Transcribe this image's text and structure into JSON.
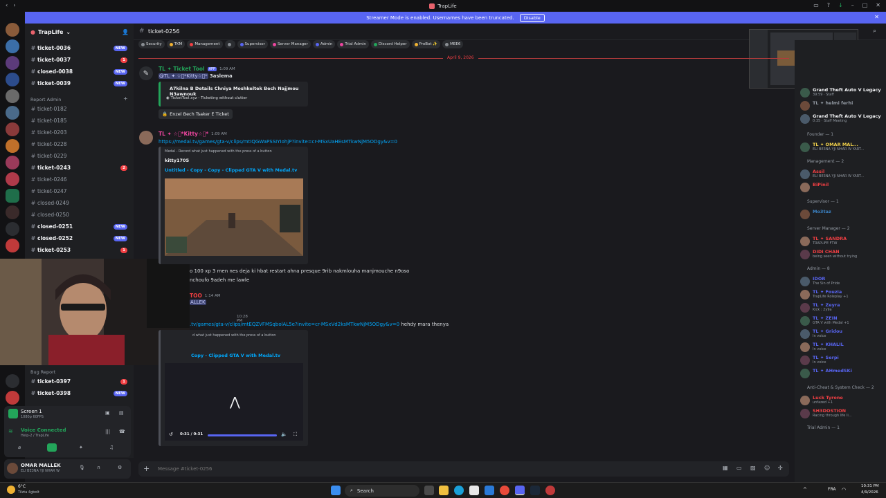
{
  "window": {
    "title": "TrapLife"
  },
  "banner": {
    "text": "Streamer Mode is enabled. Usernames have been truncated.",
    "disable": "Disable"
  },
  "server": {
    "name": "TrapLife"
  },
  "channels": [
    {
      "name": "ticket-0036",
      "bold": true,
      "badge": "NEW"
    },
    {
      "name": "ticket-0037",
      "bold": true,
      "badge": "1"
    },
    {
      "name": "closed-0038",
      "bold": true,
      "badge": "NEW"
    },
    {
      "name": "ticket-0039",
      "bold": true,
      "badge": "NEW"
    }
  ],
  "report_category": "Report Admin",
  "report_channels": [
    {
      "name": "ticket-0182",
      "bold": false,
      "badge": ""
    },
    {
      "name": "ticket-0185",
      "bold": false,
      "badge": ""
    },
    {
      "name": "ticket-0203",
      "bold": false,
      "badge": ""
    },
    {
      "name": "ticket-0228",
      "bold": false,
      "badge": ""
    },
    {
      "name": "ticket-0229",
      "bold": false,
      "badge": ""
    },
    {
      "name": "ticket-0243",
      "bold": true,
      "badge": "2"
    },
    {
      "name": "ticket-0246",
      "bold": false,
      "badge": ""
    },
    {
      "name": "ticket-0247",
      "bold": false,
      "badge": ""
    },
    {
      "name": "closed-0249",
      "bold": false,
      "badge": ""
    },
    {
      "name": "closed-0250",
      "bold": false,
      "badge": ""
    },
    {
      "name": "closed-0251",
      "bold": true,
      "badge": "NEW"
    },
    {
      "name": "closed-0252",
      "bold": true,
      "badge": "NEW"
    },
    {
      "name": "ticket-0253",
      "bold": true,
      "badge": "1"
    }
  ],
  "bug_category": "Bug Report",
  "bug_channels": [
    {
      "name": "ticket-0397",
      "bold": true,
      "badge": "1"
    },
    {
      "name": "ticket-0398",
      "bold": true,
      "badge": "NEW"
    }
  ],
  "stream": {
    "title": "Screen 1",
    "sub": "1080p 60FPS"
  },
  "voice": {
    "status": "Voice Connected",
    "channel": "Help-2 / TrapLife"
  },
  "user": {
    "name": "OMAR MALLEK",
    "status": "ELI BE3NA YJI NHAR W"
  },
  "channel_header": {
    "name": "ticket-0256"
  },
  "tags": [
    "Security",
    "TKM",
    "Management",
    "",
    "Supervisor",
    "Server Manager",
    "Admin",
    "Trial Admin",
    "Discord Helper",
    "ProBot ✨",
    "MEE6"
  ],
  "date_divider": "April 9, 2026",
  "msg1": {
    "author": "TL ✦ Ticket Tool",
    "app": "APP",
    "time": "1:09 AM",
    "mention": "@TL ✦ ☆゚*Kitty☆゚*",
    "text": "3aslema",
    "embed_title": "A7kilna B Details Chniya Moshkeltek Bech Najjmou N3awnouk",
    "embed_footer": "TicketTool.xyz - Ticketing without clutter",
    "button": "Enzel Bech Tsaker E Ticket"
  },
  "msg2": {
    "author": "TL ✦ ☆゚*Kitty☆゚*",
    "time": "1:09 AM",
    "link": "https://medal.tv/games/gta-v/clips/mtIQGWaPSSIYIohjP?invite=cr-MSxUaHEsMTkwNjM5ODgy&v=0",
    "embed_provider": "Medal - Record what just happened with the press of a button",
    "embed_author": "kitty1705",
    "embed_title": "Untitled - Copy - Copy - Clipped GTA V with Medal.tv"
  },
  "msg3": {
    "line1": "o 100 xp 3 men nes deja ki hbat restart ahna presque 9rib nakmlouha manjmouche n9oso",
    "line2": "nchoufo 9adeh me lawle"
  },
  "msg4": {
    "author": "TOO",
    "time": "1:14 AM",
    "text": "ALLEK"
  },
  "msg5": {
    "time": "10:28 PM",
    "link": ".tv/games/gta-v/clips/mtEQZVFMSqbolAL5e?invite=cr-MSxVd2ksMTkwNjM5ODgy&v=0",
    "text": "hehdy mara thenya",
    "embed_provider": "d what just happened with the press of a button",
    "embed_title": "Copy - Clipped GTA V with Medal.tv",
    "video_time": "0:31 / 0:31"
  },
  "composer": {
    "placeholder": "Message #ticket-0256"
  },
  "members": {
    "top": [
      {
        "name": "Grand Theft Auto V Legacy",
        "status": "39:59 · Staff",
        "color": "#f2f3f5"
      },
      {
        "name": "TL ✦ helmi ferhi",
        "status": "",
        "color": "#949ba4"
      },
      {
        "name": "Grand Theft Auto V Legacy",
        "status": "0:35 · Staff Meeting",
        "color": "#f2f3f5"
      }
    ],
    "founder_cat": "Founder — 1",
    "founder": [
      {
        "name": "TL ✦ OMAR MAL...",
        "status": "ELI BE3NA YJI NHAR W YART...",
        "color": "#f0d04b"
      }
    ],
    "mgmt_cat": "Management — 2",
    "mgmt": [
      {
        "name": "Assil",
        "status": "ELI BE3NA YJI NHAR W YART...",
        "color": "#f23f43"
      },
      {
        "name": "BiPinil",
        "status": "",
        "color": "#f23f43"
      }
    ],
    "sup_cat": "Supervisor — 1",
    "sup": [
      {
        "name": "Mo3taz",
        "status": "",
        "color": "#3b82c4"
      }
    ],
    "sm_cat": "Server Manager — 2",
    "sm": [
      {
        "name": "TL ✦ SANDRA",
        "status": "TRAPLIFE FTW",
        "color": "#f23f43"
      },
      {
        "name": "DIDI CHAN",
        "status": "being seen without trying",
        "color": "#f23f43"
      }
    ],
    "admin_cat": "Admin — 8",
    "admin": [
      {
        "name": "IDOR",
        "status": "The Sin of Pride",
        "color": "#5865f2"
      },
      {
        "name": "TL ✦ Fouzia",
        "status": "TrapLife Roleplay +1",
        "color": "#5865f2"
      },
      {
        "name": "TL ✦ Zeyra",
        "status": "Kick : 2y9a",
        "color": "#5865f2"
      },
      {
        "name": "TL ✦ ZEIN",
        "status": "GTA V with Medal +1",
        "color": "#5865f2"
      },
      {
        "name": "TL ✦ Gridou",
        "status": "In voice",
        "color": "#5865f2"
      },
      {
        "name": "TL ✦ KHALIL",
        "status": "In voice",
        "color": "#5865f2"
      },
      {
        "name": "TL ✦ Serpi",
        "status": "In voice",
        "color": "#5865f2"
      },
      {
        "name": "TL ✦ AHmedSKi",
        "status": "",
        "color": "#5865f2"
      }
    ],
    "ac_cat": "Anti-Cheat & System Check — 2",
    "ac": [
      {
        "name": "Luck Tyrone",
        "status": "unfazed +1",
        "color": "#f23f43"
      },
      {
        "name": "SH3DOSTION",
        "status": "Racing through life li...",
        "color": "#f23f43"
      }
    ],
    "trial_cat": "Trial Admin — 1"
  },
  "taskbar": {
    "search": "Search",
    "weather_temp": "6°C",
    "weather_text": "Tilzta 4gbolt",
    "lang": "FRA",
    "time": "10:31 PM",
    "date": "4/9/2026"
  }
}
